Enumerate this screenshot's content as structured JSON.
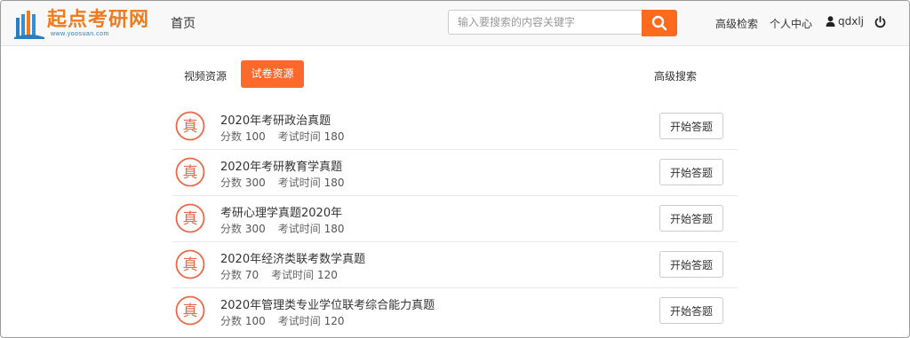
{
  "header": {
    "logo_text": "起点考研网",
    "logo_sub": "www.yoosuan.com",
    "home_label": "首页",
    "search": {
      "placeholder": "输入要搜索的内容关键字",
      "value": "",
      "button_icon": "search-icon"
    },
    "advanced_search_label": "高级检索",
    "user_center_label": "个人中心",
    "username": "qdxlj",
    "user_icon": "user-icon",
    "logout_icon": "power-icon"
  },
  "tabs": {
    "video_label": "视频资源",
    "exam_label": "试卷资源",
    "active": "exam",
    "advanced_search_label": "高级搜索"
  },
  "colors": {
    "accent": "#ff6a2b",
    "logo": "#f07a1e",
    "badge": "#e9694a"
  },
  "exams": {
    "score_label": "分数",
    "time_label": "考试时间",
    "badge_char": "真",
    "start_label": "开始答题",
    "items": [
      {
        "title": "2020年考研政治真题",
        "score": "100",
        "time": "180"
      },
      {
        "title": "2020年考研教育学真题",
        "score": "300",
        "time": "180"
      },
      {
        "title": "考研心理学真题2020年",
        "score": "300",
        "time": "180"
      },
      {
        "title": "2020年经济类联考数学真题",
        "score": "70",
        "time": "120"
      },
      {
        "title": "2020年管理类专业学位联考综合能力真题",
        "score": "100",
        "time": "120"
      }
    ]
  }
}
